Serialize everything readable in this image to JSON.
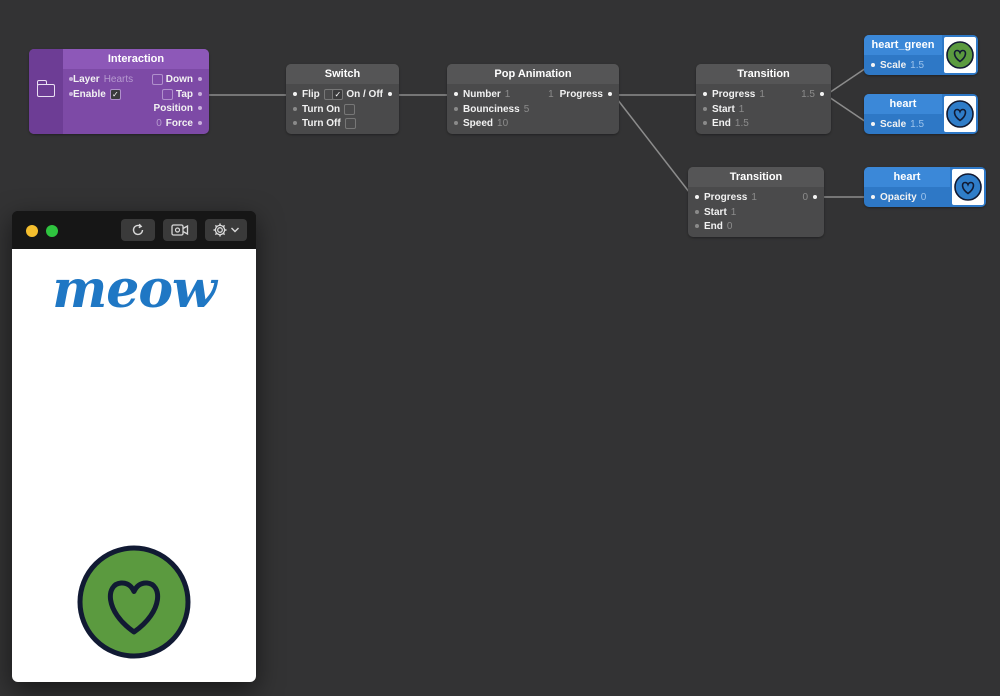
{
  "interaction": {
    "title": "Interaction",
    "icon": "folder-icon",
    "inputs": [
      {
        "label": "Layer",
        "value": "Hearts"
      },
      {
        "label": "Enable",
        "value": "✓"
      }
    ],
    "outputs": [
      {
        "label": "Down"
      },
      {
        "label": "Tap"
      },
      {
        "label": "Position"
      },
      {
        "label": "Force",
        "value": "0"
      }
    ]
  },
  "switch": {
    "title": "Switch",
    "inputs": [
      {
        "label": "Flip"
      },
      {
        "label": "Turn On"
      },
      {
        "label": "Turn Off"
      }
    ],
    "outputs": [
      {
        "label": "On / Off",
        "value": "✓"
      }
    ]
  },
  "pop_animation": {
    "title": "Pop Animation",
    "inputs": [
      {
        "label": "Number",
        "value": "1"
      },
      {
        "label": "Bounciness",
        "value": "5"
      },
      {
        "label": "Speed",
        "value": "10"
      }
    ],
    "outputs": [
      {
        "label": "Progress",
        "value": "1"
      }
    ]
  },
  "transition_1": {
    "title": "Transition",
    "inputs": [
      {
        "label": "Progress",
        "value": "1"
      },
      {
        "label": "Start",
        "value": "1"
      },
      {
        "label": "End",
        "value": "1.5"
      }
    ],
    "output_value": "1.5"
  },
  "transition_2": {
    "title": "Transition",
    "inputs": [
      {
        "label": "Progress",
        "value": "1"
      },
      {
        "label": "Start",
        "value": "1"
      },
      {
        "label": "End",
        "value": "0"
      }
    ],
    "output_value": "0"
  },
  "layer_heart_green": {
    "title": "heart_green",
    "port_label": "Scale",
    "port_value": "1.5",
    "thumb_color": "#5b9a3f"
  },
  "layer_heart": {
    "title": "heart",
    "port_label": "Scale",
    "port_value": "1.5",
    "thumb_color": "#2f7dc9"
  },
  "layer_heart_opacity": {
    "title": "heart",
    "port_label": "Opacity",
    "port_value": "0",
    "thumb_color": "#2f7dc9"
  },
  "viewer": {
    "toolbar": {
      "refresh_icon": "refresh-icon",
      "record_icon": "record-icon",
      "settings_icon": "gear-icon",
      "chevron_icon": "chevron-down-icon"
    },
    "screen_text": "meow",
    "heart_color": "#5b9a3f",
    "heart_outline_color": "#111a33",
    "brand_color": "#1f77c4"
  },
  "colors": {
    "canvas": "#333334",
    "interaction_node": "#7d4aa6",
    "patch_node": "#4a4a4b",
    "layer_node": "#2e78c6",
    "wire": "#8a8a8a"
  }
}
